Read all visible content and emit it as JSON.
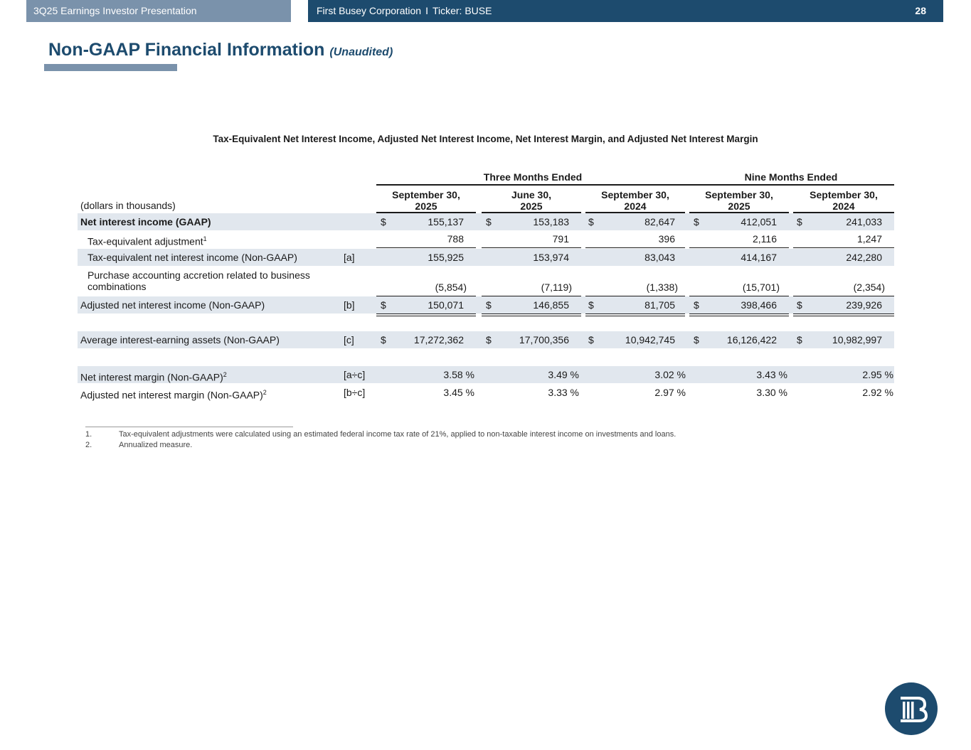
{
  "header": {
    "presentation": "3Q25 Earnings Investor Presentation",
    "company": "First Busey Corporation",
    "separator": "I",
    "ticker": "Ticker: BUSE",
    "page_number": "28"
  },
  "title": {
    "main": "Non-GAAP Financial Information",
    "sub": "(Unaudited)"
  },
  "table": {
    "heading": "Tax-Equivalent Net Interest Income, Adjusted Net Interest Income, Net Interest Margin, and Adjusted Net Interest Margin",
    "group_headers": [
      "Three Months Ended",
      "Nine Months Ended"
    ],
    "columns": [
      {
        "line1": "September 30,",
        "line2": "2025"
      },
      {
        "line1": "June 30,",
        "line2": "2025"
      },
      {
        "line1": "September 30,",
        "line2": "2024"
      },
      {
        "line1": "September 30,",
        "line2": "2025"
      },
      {
        "line1": "September 30,",
        "line2": "2024"
      }
    ],
    "units_label": "(dollars in thousands)",
    "rows": [
      {
        "label": "Net interest income (GAAP)",
        "ref": "",
        "values": [
          "155,137",
          "153,183",
          "82,647",
          "412,051",
          "241,033"
        ],
        "dollar": true
      },
      {
        "label": "Tax-equivalent adjustment",
        "sup": "1",
        "ref": "",
        "values": [
          "788",
          "791",
          "396",
          "2,116",
          "1,247"
        ]
      },
      {
        "label": "Tax-equivalent net interest income (Non-GAAP)",
        "ref": "[a]",
        "values": [
          "155,925",
          "153,974",
          "83,043",
          "414,167",
          "242,280"
        ]
      },
      {
        "label1": "Purchase accounting accretion related to business",
        "label2": "combinations",
        "ref": "",
        "values": [
          "(5,854)",
          "(7,119)",
          "(1,338)",
          "(15,701)",
          "(2,354)"
        ]
      },
      {
        "label": "Adjusted net interest income (Non-GAAP)",
        "ref": "[b]",
        "values": [
          "150,071",
          "146,855",
          "81,705",
          "398,466",
          "239,926"
        ],
        "dollar": true
      },
      {
        "label": "Average interest-earning assets (Non-GAAP)",
        "ref": "[c]",
        "values": [
          "17,272,362",
          "17,700,356",
          "10,942,745",
          "16,126,422",
          "10,982,997"
        ],
        "dollar": true
      },
      {
        "label": "Net interest margin (Non-GAAP)",
        "sup": "2",
        "ref": "[a÷c]",
        "values": [
          "3.58 %",
          "3.49 %",
          "3.02 %",
          "3.43 %",
          "2.95 %"
        ]
      },
      {
        "label": "Adjusted net interest margin (Non-GAAP)",
        "sup": "2",
        "ref": "[b÷c]",
        "values": [
          "3.45 %",
          "3.33 %",
          "2.97 %",
          "3.30 %",
          "2.92 %"
        ]
      }
    ],
    "currency_symbol": "$"
  },
  "footnotes": [
    {
      "num": "1.",
      "text": "Tax-equivalent adjustments were calculated using an estimated federal income tax rate of 21%, applied to non-taxable interest income on investments and loans."
    },
    {
      "num": "2.",
      "text": "Annualized measure."
    }
  ],
  "colors": {
    "navy": "#1d4b6e",
    "steel": "#7a92ab",
    "row_shade": "#e1e7ee"
  }
}
